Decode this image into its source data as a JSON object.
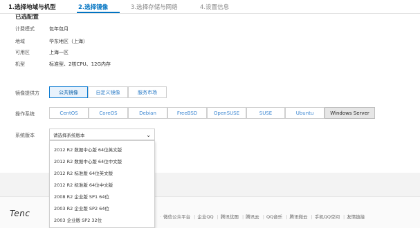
{
  "steps": [
    {
      "label": "1.选择地域与机型",
      "state": "done"
    },
    {
      "label": "2.选择镜像",
      "state": "active"
    },
    {
      "label": "3.选择存储与网络",
      "state": "todo"
    },
    {
      "label": "4.设置信息",
      "state": "todo"
    }
  ],
  "config": {
    "title": "已选配置",
    "rows": [
      {
        "label": "计费模式",
        "value": "包年包月"
      },
      {
        "label": "地域",
        "value": "华东地区（上海）"
      },
      {
        "label": "可用区",
        "value": "上海一区"
      },
      {
        "label": "机型",
        "value": "标准型、2核CPU、12G内存"
      }
    ]
  },
  "image_provider": {
    "label": "镜像提供方",
    "options": [
      "公共镜像",
      "自定义镜像",
      "服务市场"
    ],
    "selected": "公共镜像"
  },
  "os": {
    "label": "操作系统",
    "options": [
      "CentOS",
      "CoreOS",
      "Debian",
      "FreeBSD",
      "OpenSUSE",
      "SUSE",
      "Ubuntu",
      "Windows Server"
    ],
    "selected": "Windows Server"
  },
  "version": {
    "label": "系统版本",
    "placeholder": "请选择系统版本",
    "options": [
      "2012 R2 数据中心版 64位英文版",
      "2012 R2 数据中心版 64位中文版",
      "2012 R2 标准版 64位英文版",
      "2012 R2 标准版 64位中文版",
      "2008 R2 企业版 SP1 64位",
      "2003 R2 企业版 SP2 64位",
      "2003 企业版 SP2 32位"
    ]
  },
  "footer": {
    "logo": "Tenc",
    "links": [
      "微信公众平台",
      "企业QQ",
      "腾讯优图",
      "腾讯云",
      "QQ音乐",
      "腾讯微云",
      "手机QQ空间",
      "友情链接"
    ]
  },
  "colors": {
    "accent": "#0073c2",
    "selected_bg": "#e8f2fc"
  }
}
